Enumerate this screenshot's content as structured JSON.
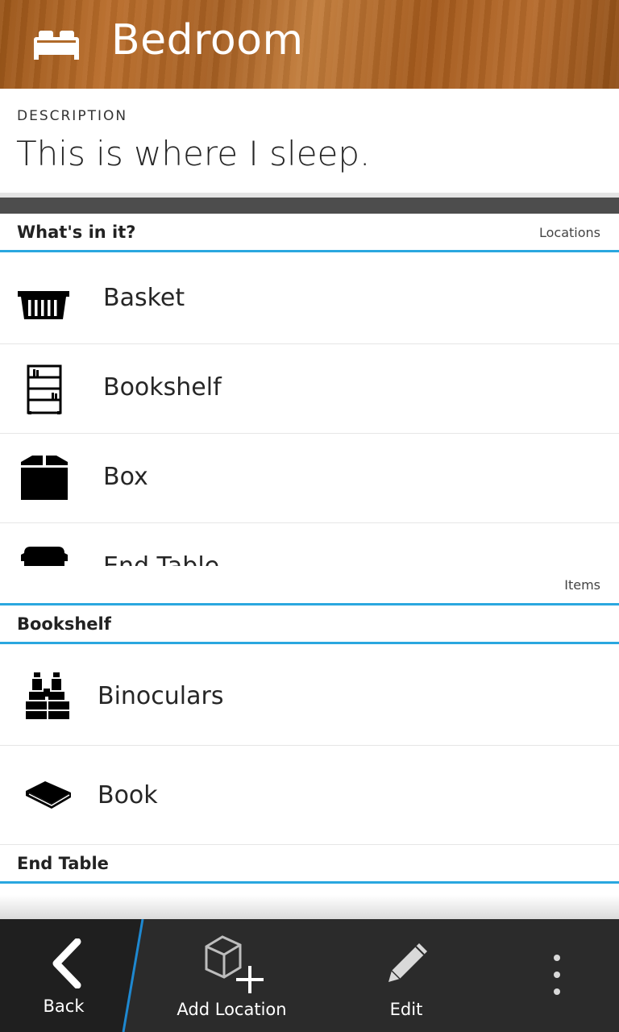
{
  "header": {
    "title": "Bedroom",
    "icon": "bed-icon"
  },
  "description": {
    "label": "DESCRIPTION",
    "text": "This is where I sleep."
  },
  "locations_section": {
    "title": "What's in it?",
    "right_label": "Locations",
    "items": [
      {
        "label": "Basket",
        "icon": "basket-icon"
      },
      {
        "label": "Bookshelf",
        "icon": "bookshelf-icon"
      },
      {
        "label": "Box",
        "icon": "box-icon"
      },
      {
        "label": "End Table",
        "icon": "end-table-icon"
      }
    ]
  },
  "items_section": {
    "right_label": "Items",
    "groups": [
      {
        "title": "Bookshelf",
        "items": [
          {
            "label": "Binoculars",
            "icon": "binoculars-icon"
          },
          {
            "label": "Book",
            "icon": "book-icon"
          }
        ]
      },
      {
        "title": "End Table",
        "items": []
      }
    ]
  },
  "action_bar": {
    "back": "Back",
    "add_location": "Add Location",
    "edit": "Edit",
    "overflow": "overflow-menu-icon"
  },
  "colors": {
    "accent": "#2aa7df",
    "action_bar": "#2b2b2b",
    "header_wood": "#a65f22"
  }
}
